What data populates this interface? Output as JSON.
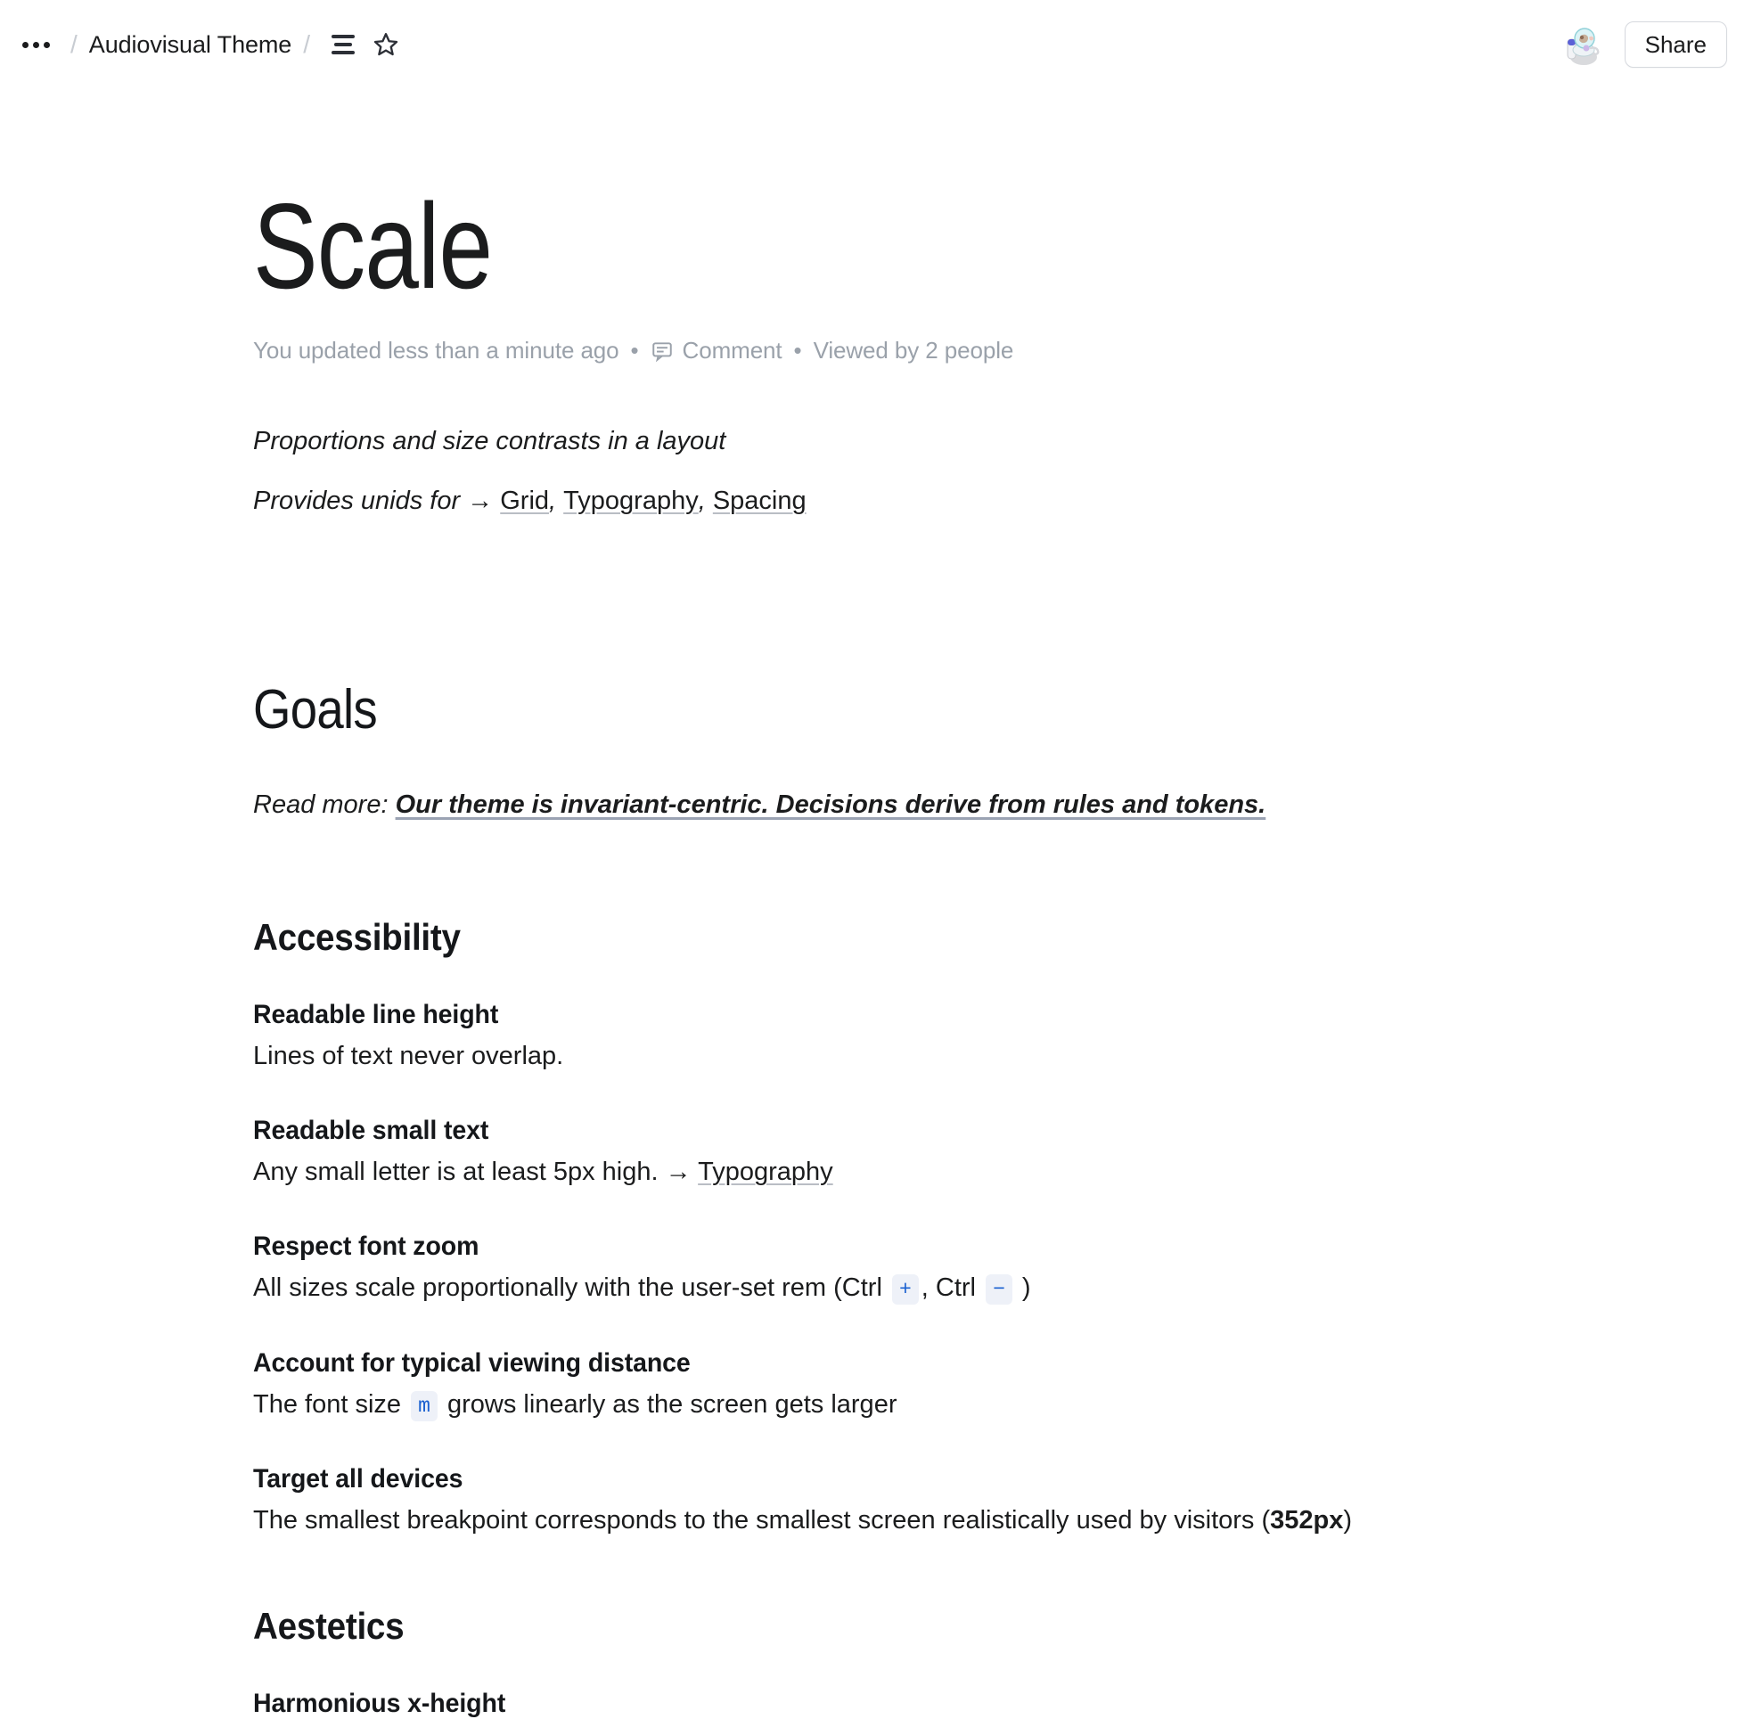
{
  "topbar": {
    "more_menu": "•••",
    "breadcrumb_separator": "/",
    "breadcrumb_title": "Audiovisual Theme",
    "outline_icon_name": "outline-icon",
    "favorite_icon_name": "star-icon",
    "avatar_name": "astronaut-avatar",
    "share_label": "Share"
  },
  "document": {
    "title": "Scale",
    "meta": {
      "updated": "You updated less than a minute ago",
      "separator": "•",
      "comment_label": "Comment",
      "viewed_label": "Viewed by 2 people"
    },
    "lead": {
      "line1": "Proportions and size contrasts in a layout",
      "line2_prefix": "Provides unids for → ",
      "links": [
        "Grid",
        "Typography",
        "Spacing"
      ],
      "comma": ", "
    },
    "goals": {
      "heading": "Goals",
      "readmore_prefix": "Read more: ",
      "readmore_link": "Our theme is invariant-centric. Decisions derive from rules and tokens.",
      "sections": [
        {
          "heading": "Accessibility",
          "items": [
            {
              "term": "Readable line height",
              "desc": "Lines of text never overlap."
            },
            {
              "term": "Readable small text",
              "desc_prefix": "Any small letter is at least 5px high. → ",
              "desc_link": "Typography"
            },
            {
              "term": "Respect font zoom",
              "desc_prefix": "All sizes scale proportionally with the user-set rem (Ctrl ",
              "kbd1": "+",
              "desc_mid": ", Ctrl ",
              "kbd2": "−",
              "desc_suffix": " )"
            },
            {
              "term": "Account for typical viewing distance",
              "desc_prefix": "The font size ",
              "code": "m",
              "desc_suffix": " grows linearly as the screen gets larger"
            },
            {
              "term": "Target all devices",
              "desc_prefix": "The smallest breakpoint corresponds to the smallest screen realistically used by visitors (",
              "desc_bold": "352px",
              "desc_suffix": ")"
            }
          ]
        },
        {
          "heading": "Aestetics",
          "items": [
            {
              "term": "Harmonious x-height"
            }
          ]
        }
      ]
    }
  },
  "colors": {
    "text": "#1b1c1d",
    "muted": "#9aa1aa",
    "link_underline": "#b9bdc4",
    "code_text": "#1a60d0",
    "code_bg": "#eef1f8",
    "border": "#d6d9de"
  }
}
